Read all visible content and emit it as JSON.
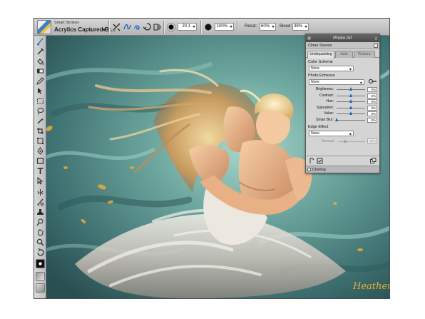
{
  "propbar": {
    "variant_category": "Smart Strokes",
    "variant_name": "Acrylics Captured Br...",
    "size_value": "20.1",
    "opacity_value": "100%",
    "resat_label": "Resat:",
    "resat_value": "60%",
    "bleed_label": "Bleed:",
    "bleed_value": "38%"
  },
  "toolbox": {
    "tools": [
      "brush-tool",
      "dropper-tool",
      "paint-bucket-tool",
      "eraser-tool",
      "layer-adjuster-tool",
      "rectangular-selection-tool",
      "lasso-tool",
      "magic-wand-tool",
      "crop-tool",
      "transform-tool",
      "pen-tool",
      "rectangle-shape-tool",
      "text-tool",
      "shape-selection-tool",
      "divine-proportion-tool",
      "mirror-painting-tool",
      "cloner-tool",
      "rubber-stamp-tool",
      "dodge-tool",
      "grabber-tool",
      "magnifier-tool",
      "rotate-page-tool"
    ]
  },
  "painting": {
    "signature": "Heather",
    "colors": {
      "sea_dark": "#2f5d5c",
      "sea_light": "#86c0b6",
      "skin": "#e9b48c",
      "hair": "#d9bb7f",
      "cloth": "#e6e0da"
    }
  },
  "photo_art": {
    "title": "Photo Art",
    "clone_source": "Clone Source",
    "tabs": [
      "Underpainting",
      "Auto",
      "Restore"
    ],
    "active_tab": "Underpainting",
    "color_scheme_label": "Color Scheme",
    "color_scheme_value": "None",
    "photo_enhance_label": "Photo Enhance",
    "photo_enhance_value": "None",
    "adjustments": [
      {
        "label": "Brightness:",
        "value": "0%",
        "level": 0.5
      },
      {
        "label": "Contrast:",
        "value": "0%",
        "level": 0.5
      },
      {
        "label": "Hue:",
        "value": "0%",
        "level": 0.5
      },
      {
        "label": "Saturation:",
        "value": "0%",
        "level": 0.5
      },
      {
        "label": "Value:",
        "value": "0%",
        "level": 0.5
      },
      {
        "label": "Smart Blur:",
        "value": "0%",
        "level": 0.0
      }
    ],
    "edge_effect_label": "Edge Effect",
    "edge_effect_value": "None",
    "amount_label": "Amount:",
    "amount_value": "25%",
    "amount_level": 0.25,
    "cloning_label": "Cloning",
    "accent_color": "#1f5fb8"
  }
}
